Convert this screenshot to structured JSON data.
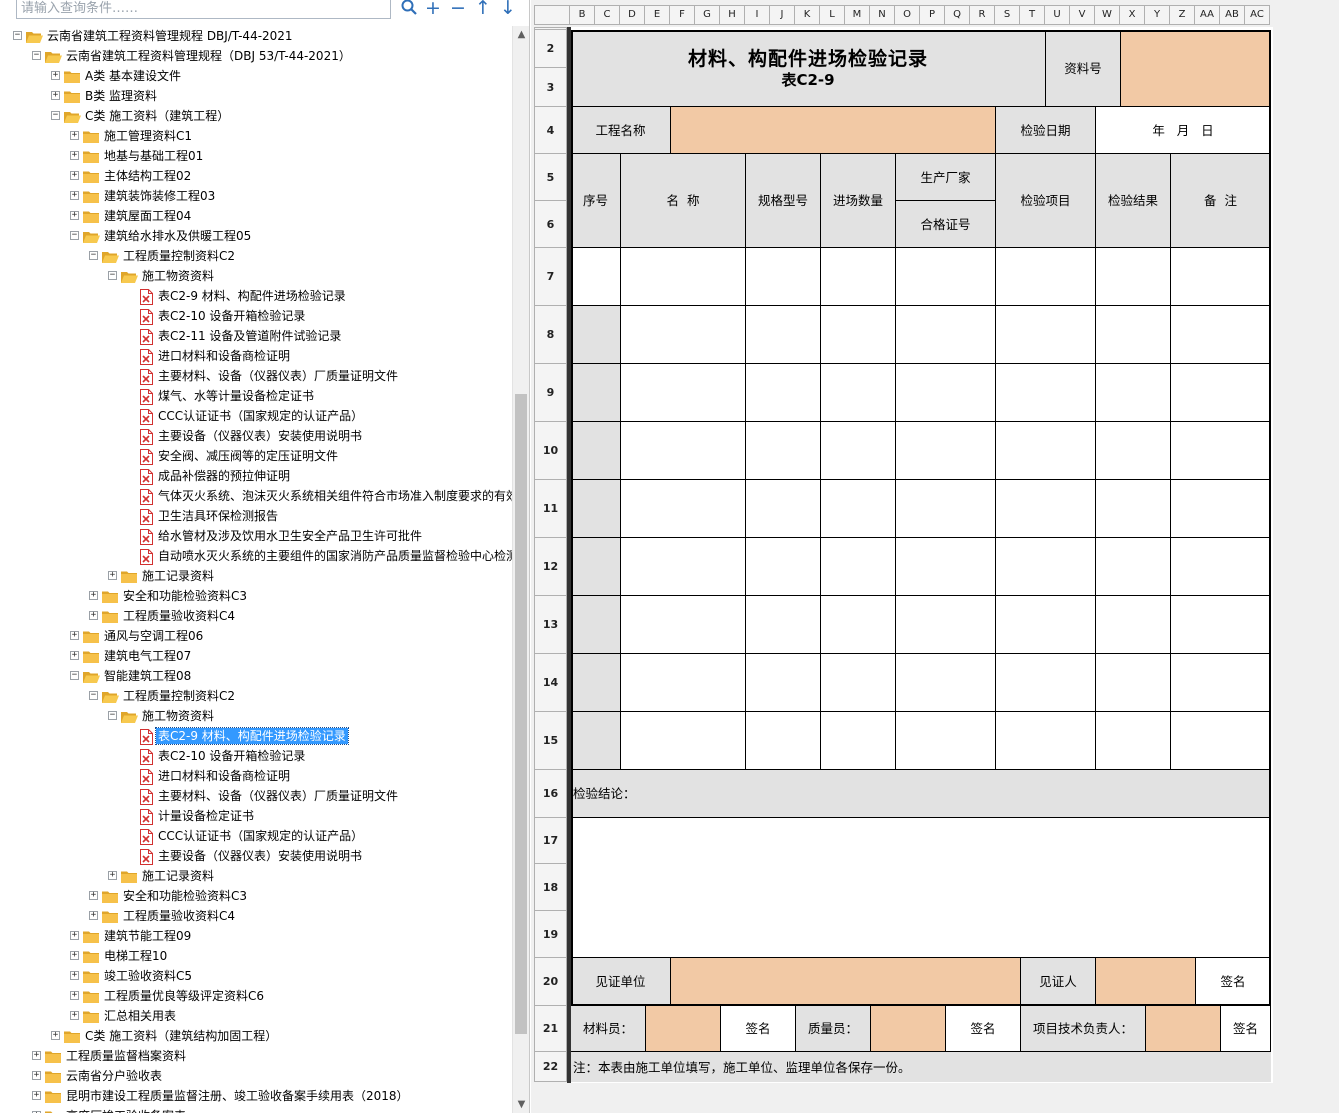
{
  "search": {
    "placeholder": "请输入查询条件……"
  },
  "toolbar": {
    "search_icon": "search-icon",
    "add": "+",
    "remove": "−",
    "up": "↑",
    "down": "↓"
  },
  "tree": [
    {
      "level": 0,
      "type": "folder",
      "open": true,
      "label": "云南省建筑工程资料管理规程 DBJ/T-44-2021"
    },
    {
      "level": 1,
      "type": "folder",
      "open": true,
      "label": "云南省建筑工程资料管理规程（DBJ 53/T-44-2021）"
    },
    {
      "level": 2,
      "type": "folder",
      "open": false,
      "label": "A类 基本建设文件"
    },
    {
      "level": 2,
      "type": "folder",
      "open": false,
      "label": "B类 监理资料"
    },
    {
      "level": 2,
      "type": "folder",
      "open": true,
      "label": "C类 施工资料（建筑工程）"
    },
    {
      "level": 3,
      "type": "folder",
      "open": false,
      "label": "施工管理资料C1"
    },
    {
      "level": 3,
      "type": "folder",
      "open": false,
      "label": "地基与基础工程01"
    },
    {
      "level": 3,
      "type": "folder",
      "open": false,
      "label": "主体结构工程02"
    },
    {
      "level": 3,
      "type": "folder",
      "open": false,
      "label": "建筑装饰装修工程03"
    },
    {
      "level": 3,
      "type": "folder",
      "open": false,
      "label": "建筑屋面工程04"
    },
    {
      "level": 3,
      "type": "folder",
      "open": true,
      "label": "建筑给水排水及供暖工程05"
    },
    {
      "level": 4,
      "type": "folder",
      "open": true,
      "label": "工程质量控制资料C2"
    },
    {
      "level": 5,
      "type": "folder",
      "open": true,
      "label": "施工物资资料"
    },
    {
      "level": 6,
      "type": "file",
      "label": "表C2-9 材料、构配件进场检验记录"
    },
    {
      "level": 6,
      "type": "file",
      "label": "表C2-10 设备开箱检验记录"
    },
    {
      "level": 6,
      "type": "file",
      "label": "表C2-11 设备及管道附件试验记录"
    },
    {
      "level": 6,
      "type": "file",
      "label": "进口材料和设备商检证明"
    },
    {
      "level": 6,
      "type": "file",
      "label": "主要材料、设备（仪器仪表）厂质量证明文件"
    },
    {
      "level": 6,
      "type": "file",
      "label": "煤气、水等计量设备检定证书"
    },
    {
      "level": 6,
      "type": "file",
      "label": "CCC认证证书（国家规定的认证产品）"
    },
    {
      "level": 6,
      "type": "file",
      "label": "主要设备（仪器仪表）安装使用说明书"
    },
    {
      "level": 6,
      "type": "file",
      "label": "安全阀、减压阀等的定压证明文件"
    },
    {
      "level": 6,
      "type": "file",
      "label": "成品补偿器的预拉伸证明"
    },
    {
      "level": 6,
      "type": "file",
      "label": "气体灭火系统、泡沫灭火系统相关组件符合市场准入制度要求的有效"
    },
    {
      "level": 6,
      "type": "file",
      "label": "卫生洁具环保检测报告"
    },
    {
      "level": 6,
      "type": "file",
      "label": "给水管材及涉及饮用水卫生安全产品卫生许可批件"
    },
    {
      "level": 6,
      "type": "file",
      "label": "自动喷水灭火系统的主要组件的国家消防产品质量监督检验中心检测"
    },
    {
      "level": 5,
      "type": "folder",
      "open": false,
      "label": "施工记录资料"
    },
    {
      "level": 4,
      "type": "folder",
      "open": false,
      "label": "安全和功能检验资料C3"
    },
    {
      "level": 4,
      "type": "folder",
      "open": false,
      "label": "工程质量验收资料C4"
    },
    {
      "level": 3,
      "type": "folder",
      "open": false,
      "label": "通风与空调工程06"
    },
    {
      "level": 3,
      "type": "folder",
      "open": false,
      "label": "建筑电气工程07"
    },
    {
      "level": 3,
      "type": "folder",
      "open": true,
      "label": "智能建筑工程08"
    },
    {
      "level": 4,
      "type": "folder",
      "open": true,
      "label": "工程质量控制资料C2"
    },
    {
      "level": 5,
      "type": "folder",
      "open": true,
      "label": "施工物资资料"
    },
    {
      "level": 6,
      "type": "file",
      "label": "表C2-9 材料、构配件进场检验记录",
      "selected": true
    },
    {
      "level": 6,
      "type": "file",
      "label": "表C2-10 设备开箱检验记录"
    },
    {
      "level": 6,
      "type": "file",
      "label": "进口材料和设备商检证明"
    },
    {
      "level": 6,
      "type": "file",
      "label": "主要材料、设备（仪器仪表）厂质量证明文件"
    },
    {
      "level": 6,
      "type": "file",
      "label": "计量设备检定证书"
    },
    {
      "level": 6,
      "type": "file",
      "label": "CCC认证证书（国家规定的认证产品）"
    },
    {
      "level": 6,
      "type": "file",
      "label": "主要设备（仪器仪表）安装使用说明书"
    },
    {
      "level": 5,
      "type": "folder",
      "open": false,
      "label": "施工记录资料"
    },
    {
      "level": 4,
      "type": "folder",
      "open": false,
      "label": "安全和功能检验资料C3"
    },
    {
      "level": 4,
      "type": "folder",
      "open": false,
      "label": "工程质量验收资料C4"
    },
    {
      "level": 3,
      "type": "folder",
      "open": false,
      "label": "建筑节能工程09"
    },
    {
      "level": 3,
      "type": "folder",
      "open": false,
      "label": "电梯工程10"
    },
    {
      "level": 3,
      "type": "folder",
      "open": false,
      "label": "竣工验收资料C5"
    },
    {
      "level": 3,
      "type": "folder",
      "open": false,
      "label": "工程质量优良等级评定资料C6"
    },
    {
      "level": 3,
      "type": "folder",
      "open": false,
      "label": "汇总相关用表"
    },
    {
      "level": 2,
      "type": "folder",
      "open": false,
      "label": "C类 施工资料（建筑结构加固工程）"
    },
    {
      "level": 1,
      "type": "folder",
      "open": false,
      "label": "工程质量监督档案资料"
    },
    {
      "level": 1,
      "type": "folder",
      "open": false,
      "label": "云南省分户验收表"
    },
    {
      "level": 1,
      "type": "folder",
      "open": false,
      "label": "昆明市建设工程质量监督注册、竣工验收备案手续用表（2018）"
    },
    {
      "level": 1,
      "type": "folder",
      "open": false,
      "label": "高度厅竣工验收备案表"
    }
  ],
  "sheet": {
    "columns": [
      "B",
      "C",
      "D",
      "E",
      "F",
      "G",
      "H",
      "I",
      "J",
      "K",
      "L",
      "M",
      "N",
      "O",
      "P",
      "Q",
      "R",
      "S",
      "T",
      "U",
      "V",
      "W",
      "X",
      "Y",
      "Z",
      "AA",
      "AB",
      "AC"
    ],
    "rows": [
      "2",
      "3",
      "4",
      "5",
      "6",
      "7",
      "8",
      "9",
      "10",
      "11",
      "12",
      "13",
      "14",
      "15",
      "16",
      "17",
      "18",
      "19",
      "20",
      "21",
      "22"
    ],
    "form": {
      "title": "材料、构配件进场检验记录",
      "subtitle": "表C2-9",
      "doc_no_label": "资料号",
      "project_name_label": "工程名称",
      "inspect_date_label": "检验日期",
      "date_placeholder": "年   月   日",
      "h_seq": "序号",
      "h_name": "名  称",
      "h_spec": "规格\n型号",
      "h_qty": "进场\n数量",
      "h_maker": "生产厂家",
      "h_cert": "合格证号",
      "h_item": "检验项目",
      "h_result": "检验\n结果",
      "h_note": "备  注",
      "conclusion_label": "检验结论：",
      "witness_unit_label": "见证单位",
      "witness_label": "见证人",
      "sign": "签名",
      "material_officer": "材料员：",
      "quality_officer": "质量员：",
      "tech_lead": "项目技术负责人：",
      "footnote": "注：本表由施工单位填写，施工单位、监理单位各保存一份。"
    }
  },
  "colors": {
    "gray": "#e2e2e2",
    "peach": "#f2c9a5",
    "selection": "#3399ff",
    "folder": "#f5c04a",
    "file_red": "#e03a3a"
  }
}
